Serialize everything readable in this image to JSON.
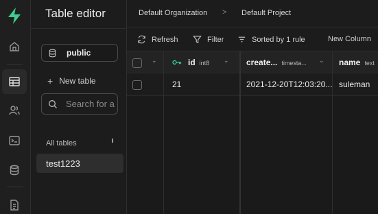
{
  "sidebar": {
    "title": "Table editor",
    "schema_label": "public",
    "new_table_label": "New table",
    "search_placeholder": "Search for a",
    "all_tables_label": "All tables",
    "tables": [
      "test1223"
    ]
  },
  "breadcrumb": {
    "organization": "Default Organization",
    "separator": ">",
    "project": "Default Project"
  },
  "toolbar": {
    "refresh": "Refresh",
    "filter": "Filter",
    "sort": "Sorted by 1 rule",
    "new_column": "New Column"
  },
  "grid": {
    "columns": [
      {
        "name": "id",
        "type": "int8"
      },
      {
        "name": "create...",
        "type": "timesta..."
      },
      {
        "name": "name",
        "type": "text"
      }
    ],
    "rows": [
      {
        "id": "21",
        "created": "2021-12-20T12:03:20...",
        "name": "suleman"
      }
    ]
  },
  "colors": {
    "brand": "#3ecf8e",
    "background": "#1c1c1c",
    "text": "#ededed"
  },
  "icons": [
    "supabase-logo-icon",
    "home-icon",
    "table-editor-icon",
    "users-icon",
    "terminal-icon",
    "database-icon",
    "document-icon",
    "database-icon",
    "search-icon",
    "refresh-icon",
    "filter-icon",
    "sort-icon",
    "key-icon",
    "chevron-down-icon"
  ]
}
